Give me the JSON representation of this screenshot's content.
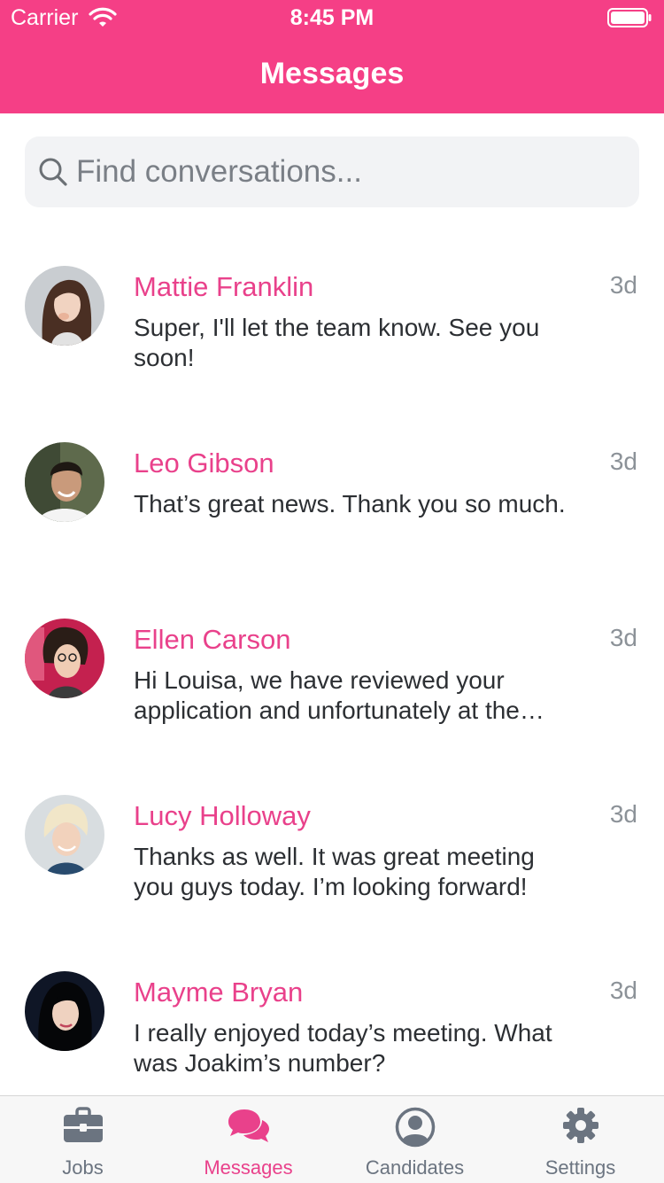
{
  "status_bar": {
    "carrier": "Carrier",
    "time": "8:45 PM"
  },
  "nav": {
    "title": "Messages"
  },
  "search": {
    "placeholder": "Find conversations..."
  },
  "conversations": [
    {
      "name": "Mattie Franklin",
      "time": "3d",
      "preview": "Super, I'll let the team know. See you soon!"
    },
    {
      "name": "Leo Gibson",
      "time": "3d",
      "preview": "That’s great news. Thank you so much."
    },
    {
      "name": "Ellen Carson",
      "time": "3d",
      "preview": "Hi Louisa, we have reviewed your application and unfortunately at the…"
    },
    {
      "name": "Lucy Holloway",
      "time": "3d",
      "preview": "Thanks as well. It was great meeting you guys today. I’m looking forward!"
    },
    {
      "name": "Mayme Bryan",
      "time": "3d",
      "preview": "I really enjoyed today’s meeting. What was Joakim’s number?"
    }
  ],
  "tabs": [
    {
      "label": "Jobs",
      "icon": "briefcase-icon"
    },
    {
      "label": "Messages",
      "icon": "chat-bubbles-icon"
    },
    {
      "label": "Candidates",
      "icon": "user-circle-icon"
    },
    {
      "label": "Settings",
      "icon": "gear-icon"
    }
  ],
  "colors": {
    "accent": "#f53f86",
    "name_text": "#e9418b",
    "tab_inactive": "#6b7480"
  }
}
